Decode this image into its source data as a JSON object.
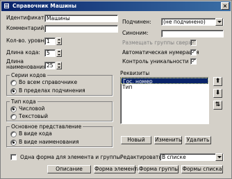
{
  "window": {
    "title": "Справочник Машины",
    "close_glyph": "×"
  },
  "left": {
    "identifier_label": "Идентификатор:",
    "identifier_value": "Машины",
    "comment_label": "Комментарий:",
    "comment_value": "",
    "levels_label": "Кол-во. уровней:",
    "levels_value": "1",
    "code_length_label": "Длина кода:",
    "code_length_value": "5",
    "name_length_label_1": "Длина",
    "name_length_label_2": "наименования:",
    "name_length_value": "25"
  },
  "right": {
    "subordinate_label": "Подчинен:",
    "subordinate_value": "(не подчинено)",
    "synonym_label": "Синоним:",
    "synonym_value": "",
    "allow_groups_top": {
      "label": "Размещать группы сверху",
      "checked": true,
      "enabled": false
    },
    "auto_numbering": {
      "label": "Автоматическая нумерация",
      "checked": true
    },
    "uniqueness": {
      "label": "Контроль уникальности",
      "checked": true
    }
  },
  "code_series": {
    "title": "Серии кодов",
    "options": [
      {
        "label": "Во всем справочнике",
        "selected": false
      },
      {
        "label": "В пределах подчинения",
        "selected": true
      }
    ]
  },
  "code_type": {
    "title": "Тип кода",
    "options": [
      {
        "label": "Числовой",
        "selected": true
      },
      {
        "label": "Текстовый",
        "selected": false
      }
    ]
  },
  "main_view": {
    "title": "Основное представление",
    "options": [
      {
        "label": "В виде кода",
        "selected": false
      },
      {
        "label": "В виде наименования",
        "selected": true
      }
    ]
  },
  "requisites": {
    "title": "Реквизиты",
    "items": [
      {
        "label": "Гос. номер",
        "selected": true
      },
      {
        "label": "Тип",
        "selected": false
      }
    ],
    "new_button": "Новый",
    "edit_button": "Изменить",
    "delete_button": "Удалить",
    "up_glyph": "⬆",
    "down_glyph": "⬇",
    "sort_glyph": "⇅"
  },
  "bottom": {
    "one_form_label": "Одна форма для элемента и группы",
    "one_form_checked": false,
    "edit_label": "Редактировать:",
    "edit_value": "В списке",
    "buttons": {
      "description": "Описание",
      "element_form": "Форма элемента",
      "group_form": "Форма группы",
      "list_forms": "Формы списка"
    }
  },
  "colors": {
    "titlebar": "#0a246a",
    "face": "#d4d0c8",
    "selection": "#0a246a"
  },
  "icons": {
    "app": "app-icon",
    "close": "close-icon",
    "up": "arrow-up-icon",
    "down": "arrow-down-icon",
    "sort": "sort-icon"
  }
}
